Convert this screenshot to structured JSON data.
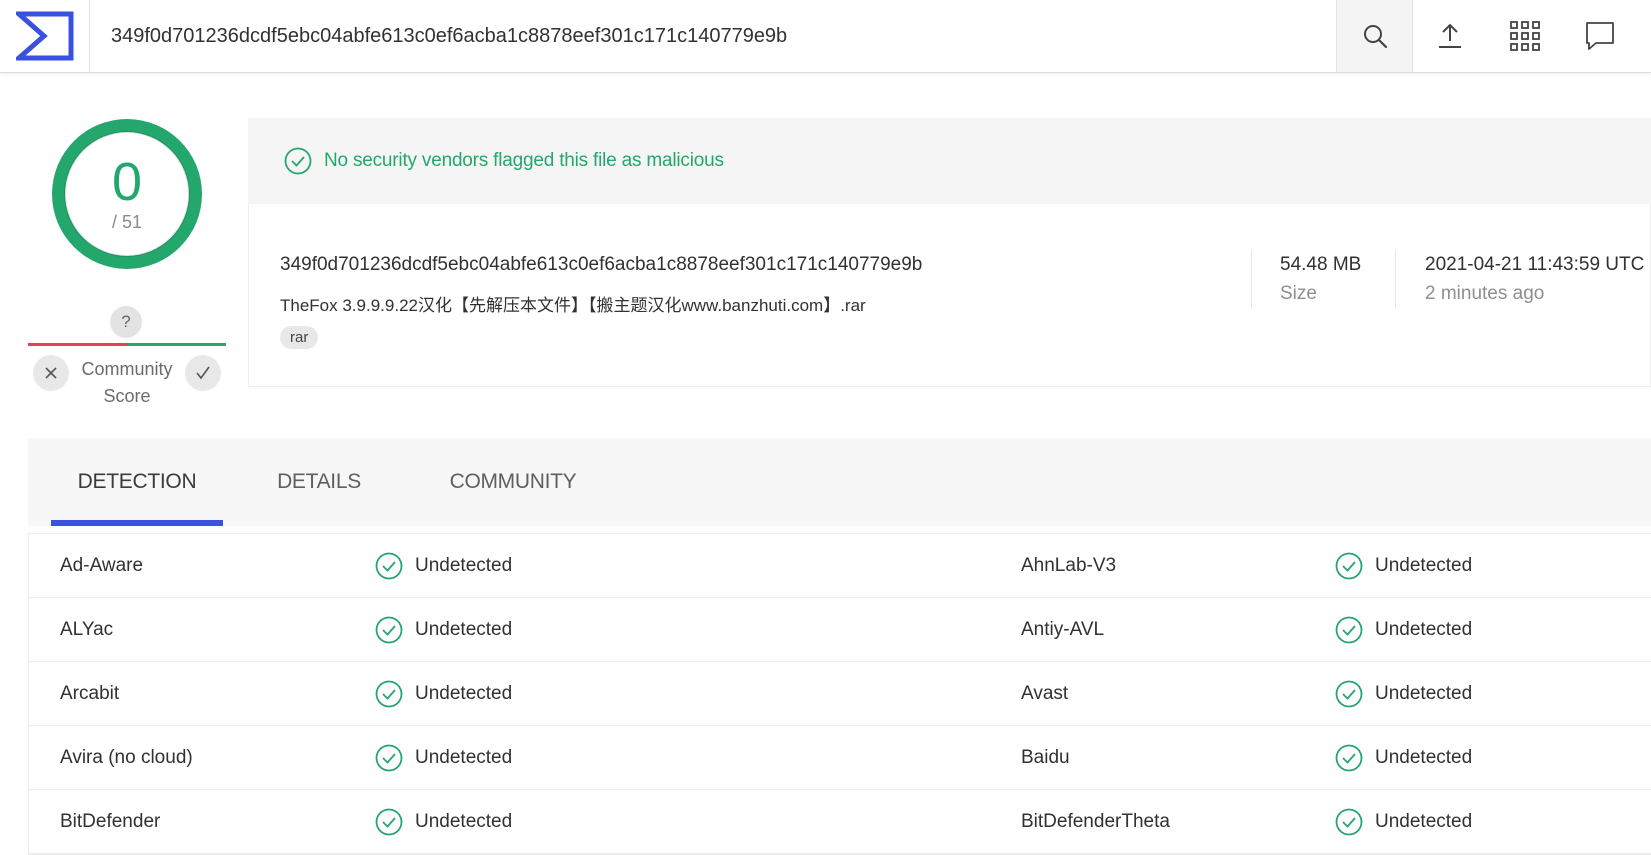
{
  "header": {
    "search_value": "349f0d701236dcdf5ebc04abfe613c0ef6acba1c8878eef301c171c140779e9b",
    "icons": [
      "logo-icon",
      "search-icon",
      "upload-icon",
      "apps-grid-icon",
      "chat-icon"
    ]
  },
  "score": {
    "detections": "0",
    "total": "/ 51",
    "color": "#24a76d"
  },
  "community": {
    "question": "?",
    "label": "Community Score",
    "colors": {
      "negative": "#e6405a",
      "positive": "#24a76d"
    }
  },
  "summary": {
    "banner": "No security vendors flagged this file as malicious",
    "hash": "349f0d701236dcdf5ebc04abfe613c0ef6acba1c8878eef301c171c140779e9b",
    "filename": "TheFox 3.9.9.9.22汉化【先解压本文件】【搬主题汉化www.banzhuti.com】.rar",
    "tag": "rar",
    "size_value": "54.48 MB",
    "size_label": "Size",
    "date_value": "2021-04-21 11:43:59 UTC",
    "date_label": "2 minutes ago"
  },
  "tabs": [
    {
      "label": "DETECTION",
      "active": true
    },
    {
      "label": "DETAILS",
      "active": false
    },
    {
      "label": "COMMUNITY",
      "active": false
    }
  ],
  "accent": "#3a50e0",
  "detections": [
    {
      "left_vendor": "Ad-Aware",
      "left_result": "Undetected",
      "right_vendor": "AhnLab-V3",
      "right_result": "Undetected"
    },
    {
      "left_vendor": "ALYac",
      "left_result": "Undetected",
      "right_vendor": "Antiy-AVL",
      "right_result": "Undetected"
    },
    {
      "left_vendor": "Arcabit",
      "left_result": "Undetected",
      "right_vendor": "Avast",
      "right_result": "Undetected"
    },
    {
      "left_vendor": "Avira (no cloud)",
      "left_result": "Undetected",
      "right_vendor": "Baidu",
      "right_result": "Undetected"
    },
    {
      "left_vendor": "BitDefender",
      "left_result": "Undetected",
      "right_vendor": "BitDefenderTheta",
      "right_result": "Undetected"
    }
  ]
}
